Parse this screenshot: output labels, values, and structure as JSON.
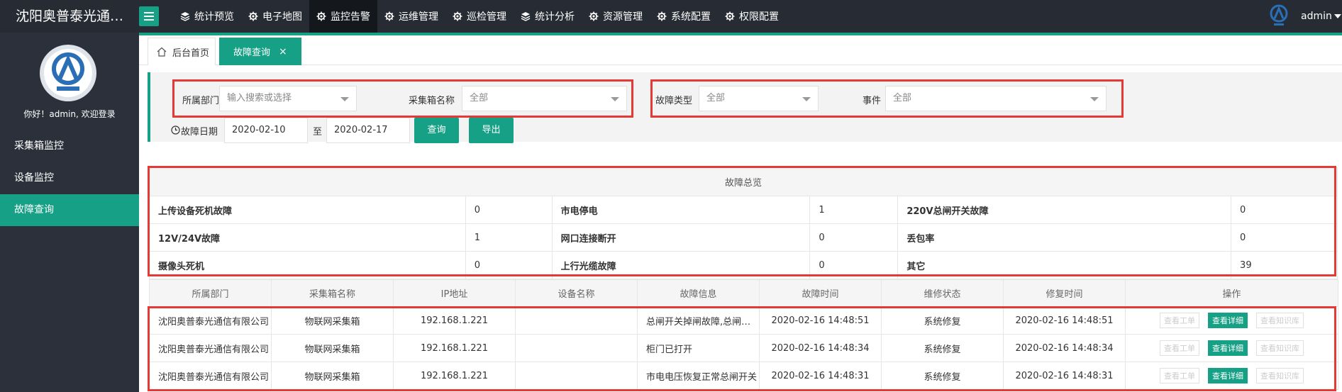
{
  "header": {
    "brand": "沈阳奥普泰光通…",
    "nav": [
      {
        "label": "统计预览",
        "icon": "layers-icon"
      },
      {
        "label": "电子地图",
        "icon": "gear-icon"
      },
      {
        "label": "监控告警",
        "icon": "gear-icon",
        "active": true
      },
      {
        "label": "运维管理",
        "icon": "gear-icon"
      },
      {
        "label": "巡检管理",
        "icon": "gear-icon"
      },
      {
        "label": "统计分析",
        "icon": "layers-icon"
      },
      {
        "label": "资源管理",
        "icon": "gear-icon"
      },
      {
        "label": "系统配置",
        "icon": "gear-icon"
      },
      {
        "label": "权限配置",
        "icon": "gear-icon"
      }
    ],
    "user": "admin"
  },
  "sidebar": {
    "welcome": "你好！admin, 欢迎登录",
    "items": [
      {
        "label": "采集箱监控"
      },
      {
        "label": "设备监控"
      },
      {
        "label": "故障查询",
        "active": true
      }
    ]
  },
  "tabs": {
    "home": "后台首页",
    "active": "故障查询",
    "close": "×"
  },
  "search": {
    "dept_label": "所属部门",
    "dept_placeholder": "输入搜索或选择",
    "box_label": "采集箱名称",
    "box_value": "全部",
    "fault_type_label": "故障类型",
    "fault_type_value": "全部",
    "event_label": "事件",
    "event_value": "全部",
    "date_label": "故障日期",
    "date_from": "2020-02-10",
    "date_sep": "至",
    "date_to": "2020-02-17",
    "query_button": "查询",
    "export_button": "导出"
  },
  "summary": {
    "title": "故障总览",
    "rows": [
      [
        {
          "k": "上传设备死机故障",
          "v": "0"
        },
        {
          "k": "市电停电",
          "v": "1"
        },
        {
          "k": "220V总闸开关故障",
          "v": "0"
        }
      ],
      [
        {
          "k": "12V/24V故障",
          "v": "1"
        },
        {
          "k": "网口连接断开",
          "v": "0"
        },
        {
          "k": "丢包率",
          "v": "0"
        }
      ],
      [
        {
          "k": "摄像头死机",
          "v": "0"
        },
        {
          "k": "上行光缆故障",
          "v": "0"
        },
        {
          "k": "其它",
          "v": "39"
        }
      ]
    ]
  },
  "records": {
    "columns": [
      "所属部门",
      "采集箱名称",
      "IP地址",
      "设备名称",
      "故障信息",
      "故障时间",
      "维修状态",
      "修复时间",
      "操作"
    ],
    "ops": {
      "ticket": "查看工单",
      "detail": "查看详细",
      "kb": "查看知识库"
    },
    "rows": [
      {
        "dept": "沈阳奥普泰光通信有限公司",
        "box": "物联网采集箱",
        "ip": "192.168.1.221",
        "device": "",
        "info": "总闸开关掉闸故障,总闸开关掉闸故障",
        "time": "2020-02-16 14:48:51",
        "status": "系统修复",
        "fixed": "2020-02-16 14:48:51"
      },
      {
        "dept": "沈阳奥普泰光通信有限公司",
        "box": "物联网采集箱",
        "ip": "192.168.1.221",
        "device": "",
        "info": "柜门已打开",
        "time": "2020-02-16 14:48:34",
        "status": "系统修复",
        "fixed": "2020-02-16 14:48:34"
      },
      {
        "dept": "沈阳奥普泰光通信有限公司",
        "box": "物联网采集箱",
        "ip": "192.168.1.221",
        "device": "",
        "info": "市电电压恢复正常总闸开关",
        "time": "2020-02-16 14:48:31",
        "status": "系统修复",
        "fixed": "2020-02-16 14:48:31"
      }
    ]
  },
  "colors": {
    "accent": "#16a085",
    "topbar": "#272b33",
    "sidebar": "#2b303a",
    "highlight": "#e53935"
  }
}
